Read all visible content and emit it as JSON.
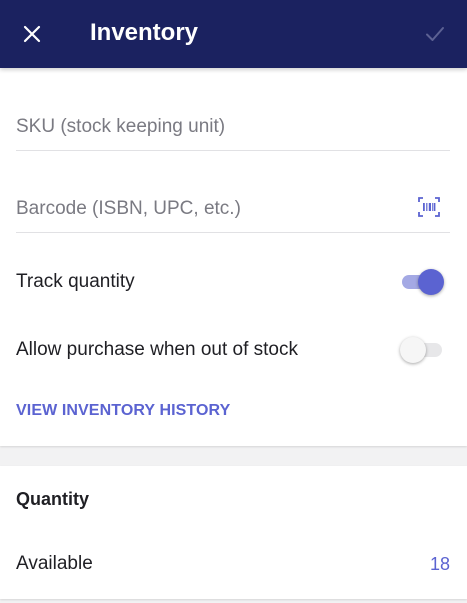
{
  "appbar": {
    "title": "Inventory",
    "close_icon": "close-icon",
    "save_icon": "checkmark-icon",
    "background": "#1b2260"
  },
  "fields": {
    "sku": {
      "placeholder": "SKU (stock keeping unit)",
      "value": ""
    },
    "barcode": {
      "placeholder": "Barcode (ISBN, UPC, etc.)",
      "value": "",
      "icon": "barcode-scan-icon"
    }
  },
  "toggles": {
    "track_quantity": {
      "label": "Track quantity",
      "checked": true
    },
    "allow_oos": {
      "label": "Allow purchase when out of stock",
      "checked": false
    }
  },
  "links": {
    "view_history": "VIEW INVENTORY HISTORY"
  },
  "quantity": {
    "title": "Quantity",
    "available_label": "Available",
    "available_value": "18"
  },
  "colors": {
    "accent": "#5b63d1",
    "accent_light": "#a4a9e4",
    "page_bg": "#f2f2f3"
  }
}
